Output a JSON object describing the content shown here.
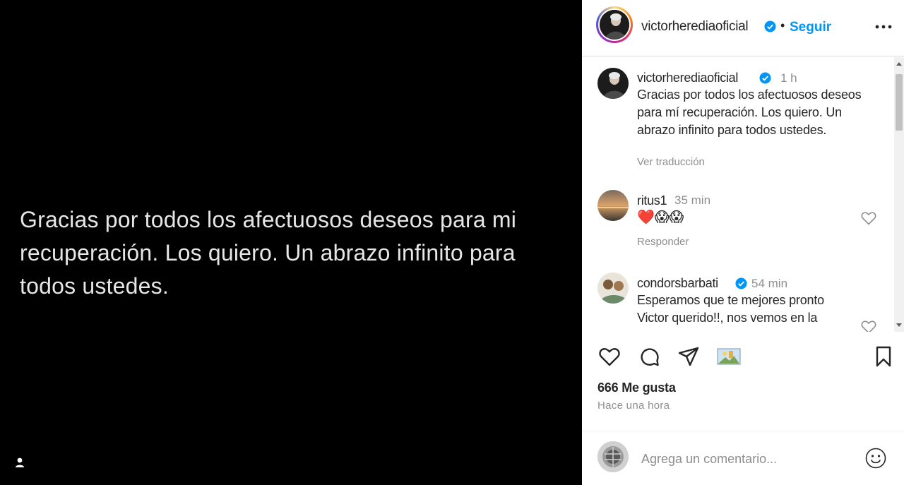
{
  "post": {
    "text": "Gracias por todos los afectuosos deseos para mi recuperación. Los quiero. Un abrazo infinito para todos ustedes."
  },
  "header": {
    "username": "victorherediaoficial",
    "separator": "•",
    "follow_label": "Seguir"
  },
  "caption": {
    "username": "victorherediaoficial",
    "time": "1 h",
    "text": "Gracias por todos los afectuosos deseos para mí recuperación. Los quiero. Un abrazo infinito para todos ustedes.",
    "translate_label": "Ver traducción"
  },
  "comments": [
    {
      "username": "ritus1",
      "time": "35 min",
      "text": "❤️😱😱",
      "reply_label": "Responder"
    },
    {
      "username": "condorsbarbati",
      "time": "54 min",
      "text": "Esperamos que te mejores pronto Victor querido!!, nos vemos en la"
    }
  ],
  "stats": {
    "likes": "666 Me gusta",
    "time_ago": "Hace una hora"
  },
  "comment_box": {
    "placeholder": "Agrega un comentario..."
  },
  "colors": {
    "accent": "#0095f6",
    "verified": "#0095f6",
    "like_red": "#ed4956"
  },
  "icons": [
    "user-tag-icon",
    "verified-badge-icon",
    "more-options-icon",
    "heart-icon",
    "comment-icon",
    "share-icon",
    "photo-icon",
    "bookmark-icon",
    "emoji-icon"
  ]
}
